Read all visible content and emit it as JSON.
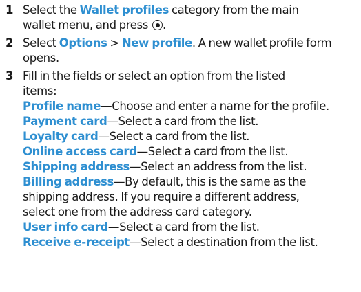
{
  "steps": [
    {
      "number": "1",
      "line1_pre": "Select the ",
      "line1_kw": "Wallet profiles",
      "line1_post": " category from the main",
      "line2_pre": "wallet menu, and press",
      "line2_post": ".",
      "select_key_icon": "select-key-icon"
    },
    {
      "number": "2",
      "line1_pre": "Select ",
      "line1_kw1": "Options",
      "line1_sep": " > ",
      "line1_kw2": "New profile",
      "line1_post": ". A new wallet profile form",
      "line2": "opens."
    },
    {
      "number": "3",
      "line1": "Fill in the fields or select an option from the listed",
      "line2": "items:",
      "fields": [
        {
          "name": "Profile name",
          "desc": "—Choose and enter a name for the profile."
        },
        {
          "name": "Payment card",
          "desc": "—Select a card from the list."
        },
        {
          "name": "Loyalty card",
          "desc": "—Select a card from the list."
        },
        {
          "name": "Online access card",
          "desc": "—Select a card from the list."
        },
        {
          "name": "Shipping address",
          "desc": "—Select an address from the list."
        },
        {
          "name": "Billing address",
          "desc": "—By default, this is the same as the"
        },
        {
          "name": "User info card",
          "desc": "—Select a card from the list."
        },
        {
          "name": "Receive e-receipt",
          "desc": "—Select a destination from the list."
        }
      ],
      "billing_cont1": "shipping address. If you require a different address,",
      "billing_cont2": "select one from the address card category."
    }
  ],
  "colors": {
    "keyword": "#2e8fd1",
    "text": "#1a1a1a"
  }
}
